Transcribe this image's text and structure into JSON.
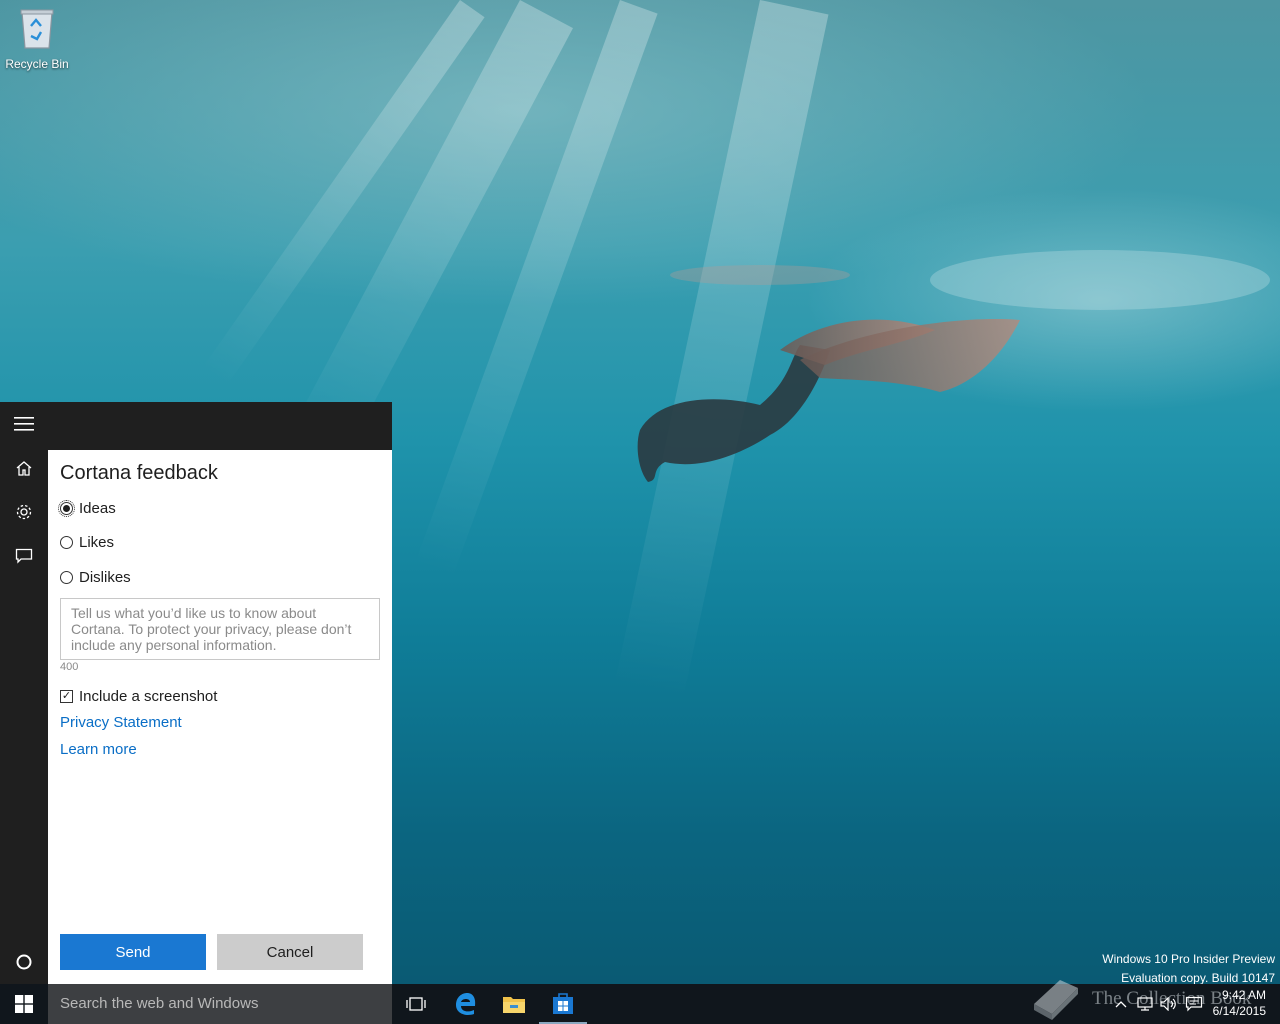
{
  "desktop": {
    "recycle_bin_label": "Recycle Bin",
    "watermark_line1": "Windows 10 Pro Insider Preview",
    "watermark_line2": "Evaluation copy. Build 10147"
  },
  "cortana": {
    "rail": [
      {
        "name": "hamburger-menu-icon"
      },
      {
        "name": "home-icon"
      },
      {
        "name": "gear-icon"
      },
      {
        "name": "feedback-icon"
      },
      {
        "name": "cortana-circle-icon"
      }
    ],
    "feedback": {
      "title": "Cortana feedback",
      "options": [
        {
          "label": "Ideas",
          "checked": true
        },
        {
          "label": "Likes",
          "checked": false
        },
        {
          "label": "Dislikes",
          "checked": false
        }
      ],
      "textarea_placeholder": "Tell us what you’d like us to know about Cortana. To protect your privacy, please don’t include any personal information.",
      "char_count": "400",
      "include_screenshot_label": "Include a screenshot",
      "include_screenshot_checked": true,
      "privacy_link": "Privacy Statement",
      "learn_more_link": "Learn more",
      "send_label": "Send",
      "cancel_label": "Cancel"
    }
  },
  "taskbar": {
    "search_placeholder": "Search the web and Windows",
    "apps": [
      "task-view-icon",
      "edge-icon",
      "file-explorer-icon",
      "store-icon"
    ],
    "overlay_text": "The Collection Book",
    "clock_time": "9:42 AM",
    "clock_date": "6/14/2015"
  },
  "colors": {
    "accent": "#1a78d2",
    "link": "#0a6ec6",
    "panel_dark": "#1f1f1f",
    "taskbar": "#10161c"
  }
}
